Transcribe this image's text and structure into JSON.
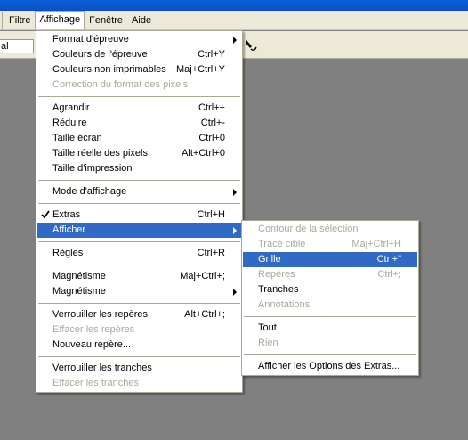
{
  "menubar": {
    "items": [
      "Filtre",
      "Affichage",
      "Fenêtre",
      "Aide"
    ]
  },
  "toolbar": {
    "field_value": "al",
    "tool_icon": "pen-tool-icon"
  },
  "affichage_menu": {
    "items": [
      {
        "label": "Format d'épreuve",
        "shortcut": "",
        "submenu": true,
        "disabled": false
      },
      {
        "label": "Couleurs de l'épreuve",
        "shortcut": "Ctrl+Y",
        "disabled": false
      },
      {
        "label": "Couleurs non imprimables",
        "shortcut": "Maj+Ctrl+Y",
        "disabled": false
      },
      {
        "label": "Correction du format des pixels",
        "shortcut": "",
        "disabled": true
      },
      {
        "label": "Agrandir",
        "shortcut": "Ctrl++",
        "disabled": false
      },
      {
        "label": "Réduire",
        "shortcut": "Ctrl+-",
        "disabled": false
      },
      {
        "label": "Taille écran",
        "shortcut": "Ctrl+0",
        "disabled": false
      },
      {
        "label": "Taille réelle des pixels",
        "shortcut": "Alt+Ctrl+0",
        "disabled": false
      },
      {
        "label": "Taille d'impression",
        "shortcut": "",
        "disabled": false
      },
      {
        "label": "Mode d'affichage",
        "shortcut": "",
        "submenu": true,
        "disabled": false
      },
      {
        "label": "Extras",
        "shortcut": "Ctrl+H",
        "checked": true,
        "disabled": false
      },
      {
        "label": "Afficher",
        "shortcut": "",
        "submenu": true,
        "highlighted": true,
        "disabled": false
      },
      {
        "label": "Règles",
        "shortcut": "Ctrl+R",
        "disabled": false
      },
      {
        "label": "Magnétisme",
        "shortcut": "Maj+Ctrl+;",
        "disabled": false
      },
      {
        "label": "Magnétisme",
        "shortcut": "",
        "submenu": true,
        "disabled": false
      },
      {
        "label": "Verrouiller les repères",
        "shortcut": "Alt+Ctrl+;",
        "disabled": false
      },
      {
        "label": "Effacer les repères",
        "shortcut": "",
        "disabled": true
      },
      {
        "label": "Nouveau repère...",
        "shortcut": "",
        "disabled": false
      },
      {
        "label": "Verrouiller les tranches",
        "shortcut": "",
        "disabled": false
      },
      {
        "label": "Effacer les tranches",
        "shortcut": "",
        "disabled": true
      }
    ]
  },
  "afficher_submenu": {
    "items": [
      {
        "label": "Contour de la sélection",
        "shortcut": "",
        "disabled": true
      },
      {
        "label": "Tracé cible",
        "shortcut": "Maj+Ctrl+H",
        "disabled": true
      },
      {
        "label": "Grille",
        "shortcut": "Ctrl+\"",
        "highlighted": true,
        "disabled": false
      },
      {
        "label": "Repères",
        "shortcut": "Ctrl+;",
        "disabled": true
      },
      {
        "label": "Tranches",
        "shortcut": "",
        "disabled": false
      },
      {
        "label": "Annotations",
        "shortcut": "",
        "disabled": true
      },
      {
        "label": "Tout",
        "shortcut": "",
        "disabled": false
      },
      {
        "label": "Rien",
        "shortcut": "",
        "disabled": true
      },
      {
        "label": "Afficher les Options des Extras...",
        "shortcut": "",
        "disabled": false
      }
    ]
  },
  "colors": {
    "highlight": "#316ac5",
    "menubar": "#ece9d8",
    "disabled_text": "#aca899",
    "workspace": "#808080",
    "titlebar": "#0a5fd9"
  }
}
